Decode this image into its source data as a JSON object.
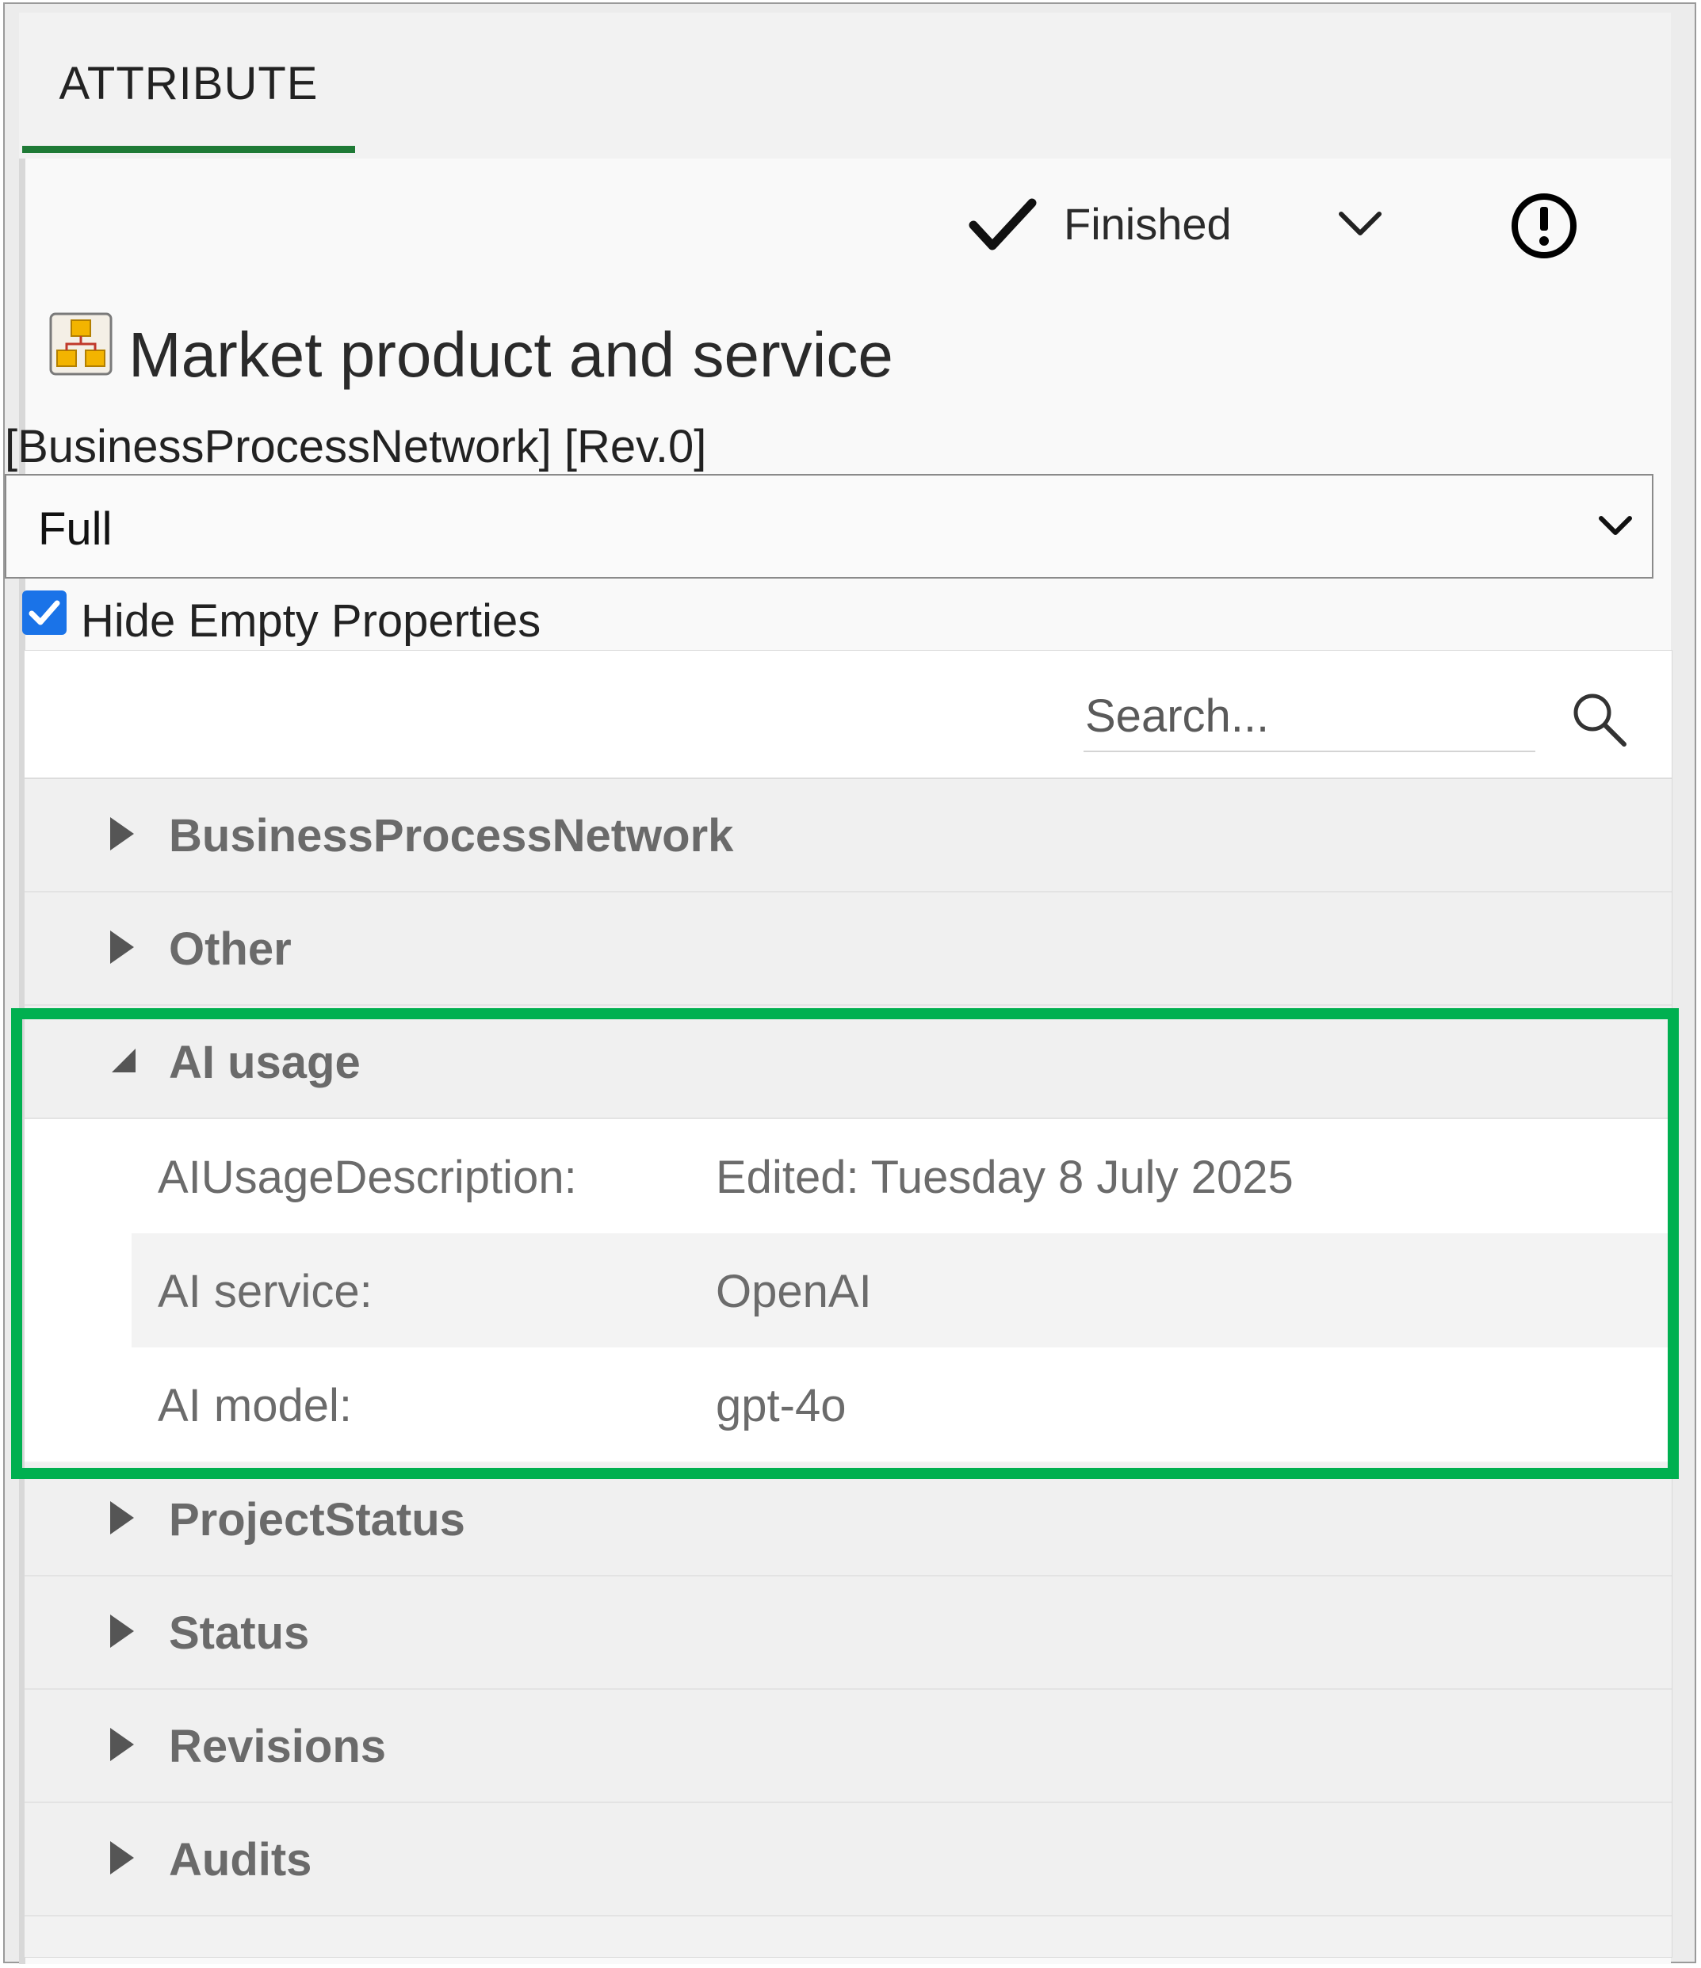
{
  "tab": {
    "label": "ATTRIBUTE"
  },
  "status": {
    "label": "Finished"
  },
  "object": {
    "title": "Market product and service",
    "type_rev": "[BusinessProcessNetwork] [Rev.0]"
  },
  "view_select": {
    "value": "Full"
  },
  "hide_empty": {
    "label": "Hide Empty Properties",
    "checked": true
  },
  "search": {
    "placeholder": "Search..."
  },
  "categories": [
    {
      "label": "BusinessProcessNetwork",
      "expanded": false
    },
    {
      "label": "Other",
      "expanded": false
    },
    {
      "label": "AI usage",
      "expanded": true
    },
    {
      "label": "ProjectStatus",
      "expanded": false
    },
    {
      "label": "Status",
      "expanded": false
    },
    {
      "label": "Revisions",
      "expanded": false
    },
    {
      "label": "Audits",
      "expanded": false
    }
  ],
  "ai_usage_properties": [
    {
      "key": "AIUsageDescription:",
      "value": "Edited: Tuesday 8 July 2025"
    },
    {
      "key": "AI service:",
      "value": "OpenAI"
    },
    {
      "key": "AI model:",
      "value": "gpt-4o"
    }
  ],
  "colors": {
    "accent_tab": "#1f7a36",
    "highlight_border": "#00b050",
    "checkbox": "#1a73e8"
  }
}
